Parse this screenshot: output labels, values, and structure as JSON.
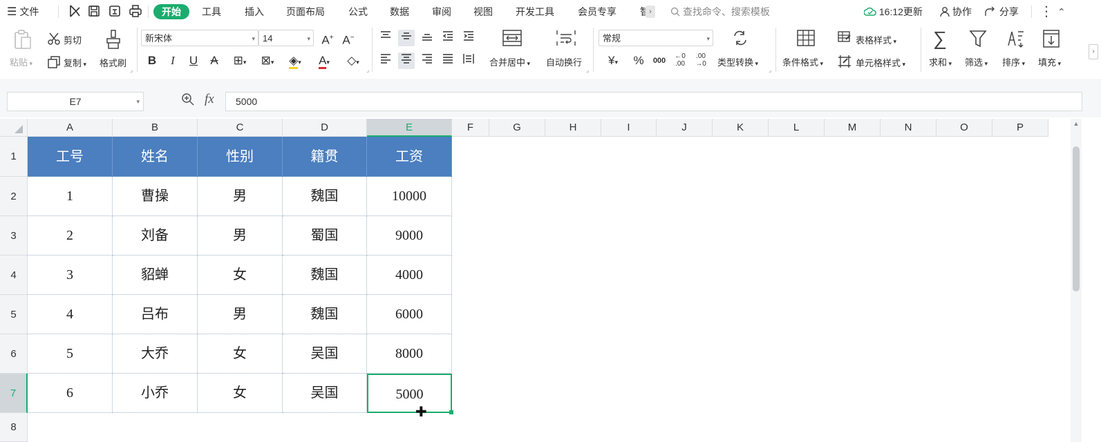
{
  "menubar": {
    "file_label": "文件",
    "tabs": [
      {
        "label": "开始",
        "active": true
      },
      {
        "label": "工具"
      },
      {
        "label": "插入"
      },
      {
        "label": "页面布局"
      },
      {
        "label": "公式"
      },
      {
        "label": "数据"
      },
      {
        "label": "审阅"
      },
      {
        "label": "视图"
      },
      {
        "label": "开发工具"
      },
      {
        "label": "会员专享"
      },
      {
        "label": "智"
      }
    ],
    "search_placeholder": "查找命令、搜索模板",
    "sync_label": "16:12更新",
    "collab_label": "协作",
    "share_label": "分享"
  },
  "ribbon": {
    "paste": "粘贴",
    "cut": "剪切",
    "copy": "复制",
    "format_painter": "格式刷",
    "font_name": "新宋体",
    "font_size": "14",
    "merge_center": "合并居中",
    "wrap_text": "自动换行",
    "number_format": "常规",
    "convert_type": "类型转换",
    "conditional_format": "条件格式",
    "table_style": "表格样式",
    "cell_style": "单元格样式",
    "sum": "求和",
    "filter": "筛选",
    "sort": "排序",
    "fill": "填充"
  },
  "formula_bar": {
    "name_box": "E7",
    "fx": "fx",
    "content": "5000"
  },
  "sheet": {
    "columns": [
      "A",
      "B",
      "C",
      "D",
      "E",
      "F",
      "G",
      "H",
      "I",
      "J",
      "K",
      "L",
      "M",
      "N",
      "O",
      "P"
    ],
    "rows": [
      "1",
      "2",
      "3",
      "4",
      "5",
      "6",
      "7",
      "8"
    ],
    "selected_column": "E",
    "selected_row": "7",
    "table": {
      "headers": [
        "工号",
        "姓名",
        "性别",
        "籍贯",
        "工资"
      ],
      "data": [
        [
          "1",
          "曹操",
          "男",
          "魏国",
          "10000"
        ],
        [
          "2",
          "刘备",
          "男",
          "蜀国",
          "9000"
        ],
        [
          "3",
          "貂蝉",
          "女",
          "魏国",
          "4000"
        ],
        [
          "4",
          "吕布",
          "男",
          "魏国",
          "6000"
        ],
        [
          "5",
          "大乔",
          "女",
          "吴国",
          "8000"
        ],
        [
          "6",
          "小乔",
          "女",
          "吴国",
          "5000"
        ]
      ]
    }
  },
  "colors": {
    "accent": "#1aad6e",
    "header_fill": "#4b7fbf"
  }
}
